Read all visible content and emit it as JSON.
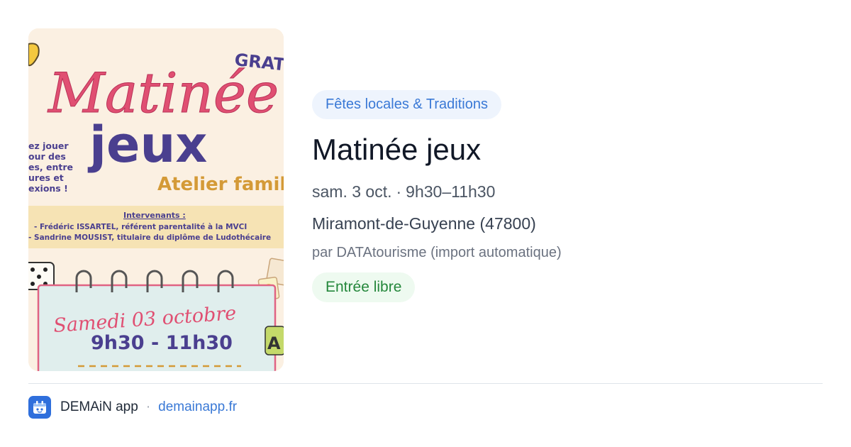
{
  "poster": {
    "title_script": "Matinée",
    "title_bold": "jeux",
    "badge": "GRAT",
    "subtitle": "Atelier famil",
    "side_text": [
      "ez jouer",
      "our des",
      "es, entre",
      "ures et",
      "exions  !"
    ],
    "speakers_label": "Intervenants :",
    "speakers": [
      "- Frédéric ISSARTEL, référent parentalité à la MVCI",
      "- Sandrine MOUSIST, titulaire du diplôme de Ludothécaire"
    ],
    "calendar_date": "Samedi 03 octobre",
    "calendar_time": "9h30 - 11h30"
  },
  "event": {
    "category": "Fêtes locales & Traditions",
    "title": "Matinée jeux",
    "date": "sam. 3 oct.",
    "separator": "·",
    "time": "9h30–11h30",
    "location": "Miramont-de-Guyenne (47800)",
    "source": "par DATAtourisme (import automatique)",
    "price": "Entrée libre"
  },
  "footer": {
    "app_name": "DEMAiN app",
    "separator": "·",
    "link": "demainapp.fr",
    "icon": "demain-app-icon"
  },
  "colors": {
    "category_bg": "#eef4fd",
    "category_text": "#3a79d6",
    "price_bg": "#eefaf0",
    "price_text": "#24873b",
    "link": "#3a79d6",
    "poster_pink": "#e04f72",
    "poster_purple": "#4a3f8f",
    "poster_gold": "#d49a37"
  }
}
